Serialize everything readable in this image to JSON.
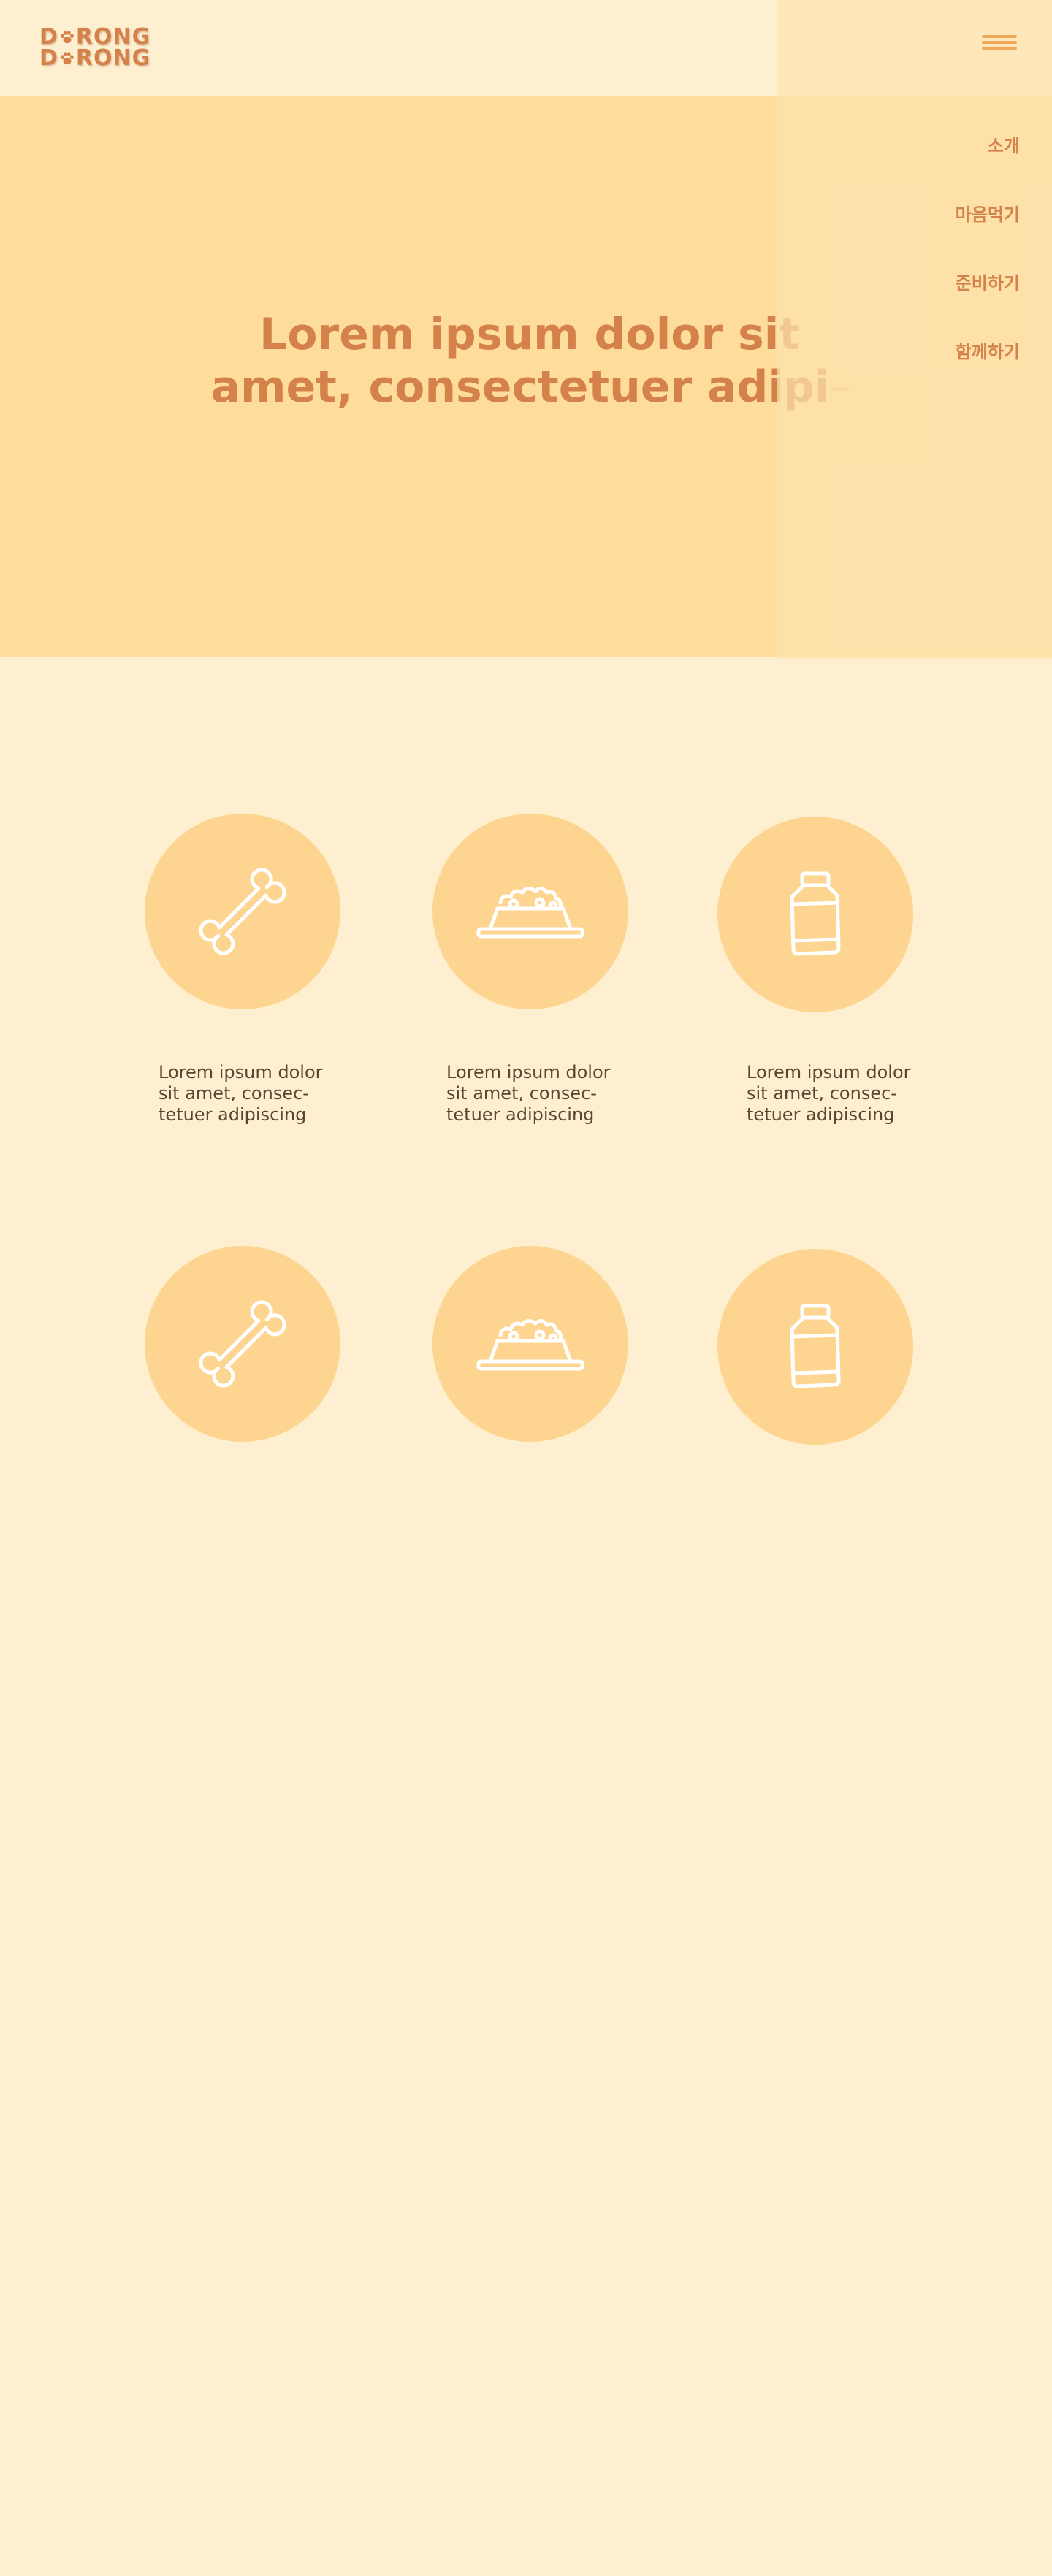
{
  "logo": {
    "line1_a": "D",
    "line1_b": "RONG",
    "line2_a": "D",
    "line2_b": "RONG"
  },
  "hero": {
    "title_line1": "Lorem ipsum dolor sit",
    "title_line2": "amet, consectetuer adipi"
  },
  "menu": {
    "items": [
      "소개",
      "마음먹기",
      "준비하기",
      "함께하기"
    ]
  },
  "features": [
    {
      "icon": "bone-icon",
      "text": [
        "Lorem ipsum dolor",
        "sit amet, consec-",
        "tetuer adipiscing"
      ]
    },
    {
      "icon": "food-bowl-icon",
      "text": [
        "Lorem ipsum dolor",
        "sit amet, consec-",
        "tetuer adipiscing"
      ]
    },
    {
      "icon": "medicine-bottle-icon",
      "text": [
        "Lorem ipsum dolor",
        "sit amet, consec-",
        "tetuer adipiscing"
      ]
    },
    {
      "icon": "bone-icon"
    },
    {
      "icon": "food-bowl-icon"
    },
    {
      "icon": "medicine-bottle-icon"
    }
  ],
  "colors": {
    "background": "#fdefd0",
    "hero": "#fddc9c",
    "accent": "#d4824a",
    "circle": "#fdd591",
    "menu_icon": "#f2a85a",
    "text": "#5a4631"
  }
}
